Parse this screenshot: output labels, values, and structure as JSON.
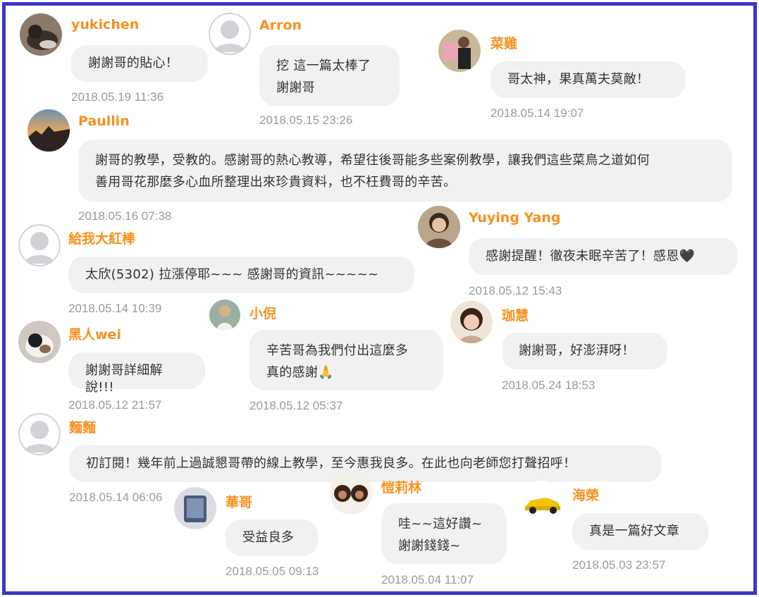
{
  "colors": {
    "border": "#3b37c9",
    "name": "#f5911e",
    "bubble": "#f1f1f1",
    "time": "#9a9a9a"
  },
  "comments": [
    {
      "name": "yukichen",
      "text": "謝謝哥的貼心！",
      "time": "2018.05.19 11:36",
      "avatar": "cat-photo-avatar"
    },
    {
      "name": "Arron",
      "text": "挖 這一篇太棒了\n謝謝哥",
      "time": "2018.05.15 23:26",
      "avatar": "default-user-avatar"
    },
    {
      "name": "菜雞",
      "text": "哥太神，果真萬夫莫敵！",
      "time": "2018.05.14 19:07",
      "avatar": "person-photo-avatar"
    },
    {
      "name": "Paullin",
      "text": "謝哥的教學，受教的。感謝哥的熱心教導，希望往後哥能多些案例教學，讓我們這些菜鳥之道如何\n善用哥花那麼多心血所整理出來珍貴資料，也不枉費哥的辛苦。",
      "time": "2018.05.16 07:38",
      "avatar": "sunset-photo-avatar"
    },
    {
      "name": "Yuying Yang",
      "text": "感謝提醒！徹夜未眠辛苦了！感恩🖤",
      "time": "2018.05.12 15:43",
      "avatar": "woman-photo-avatar"
    },
    {
      "name": "給我大紅棒",
      "text": "太欣(5302) 拉漲停耶~~~ 感謝哥的資訊~~~~~",
      "time": "2018.05.14 10:39",
      "avatar": "default-user-avatar"
    },
    {
      "name": "小倪",
      "text": "辛苦哥為我們付出這麼多\n真的感謝🙏",
      "time": "2018.05.12 05:37",
      "avatar": "man-photo-avatar"
    },
    {
      "name": "珈慧",
      "text": "謝謝哥，好澎湃呀！",
      "time": "2018.05.24 18:53",
      "avatar": "girl-photo-avatar"
    },
    {
      "name": "黑人wei",
      "text": "謝謝哥詳細解說!!!",
      "time": "2018.05.12 21:57",
      "avatar": "cat-photo-avatar"
    },
    {
      "name": "麵麵",
      "text": "初訂閱！幾年前上過誠懇哥帶的線上教學，至今惠我良多。在此也向老師您打聲招呼！",
      "time": "2018.05.14 06:06",
      "avatar": "default-user-avatar"
    },
    {
      "name": "華哥",
      "text": "受益良多",
      "time": "2018.05.05 09:13",
      "avatar": "photo-avatar"
    },
    {
      "name": "愷莉林",
      "text": "哇~~這好讚~\n謝謝錢錢~",
      "time": "2018.05.04 11:07",
      "avatar": "monkeys-photo-avatar"
    },
    {
      "name": "海榮",
      "text": "真是一篇好文章",
      "time": "2018.05.03 23:57",
      "avatar": "car-photo-avatar"
    }
  ]
}
